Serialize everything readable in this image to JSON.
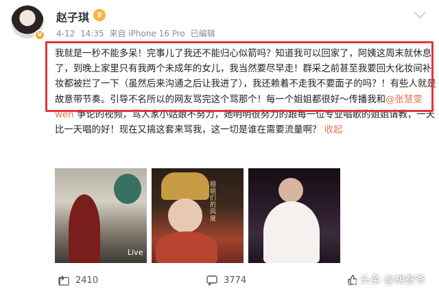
{
  "post": {
    "author": {
      "name": "赵子琪",
      "badge_icon": "crown-badge-icon",
      "vip_glyph": "V"
    },
    "meta": {
      "date": "4-12",
      "time": "14:35",
      "source": "来自 iPhone 16 Pro",
      "edited": "已编辑"
    },
    "text": {
      "p1": "我就是一秒不能多呆！完事儿了我还不能归心似箭吗？知道我可以回家了，阿姨这周末就休息了，到晚上家里只有我两个未成年的女儿，我当然要尽早走！群采之前甚至我要回大化妆间补妆都被拦了一下（虽然后来沟通之后让我进了），我还赖着不走我不要面子的吗？！有些人就是故意带节奏。引导不名所以的网友骂完这个骂那个！每一个姐姐都很好～传播我和",
      "mention": "@张慧雯wen",
      "p2": " 争论的视频，骂人家小姑娘不努力，她明明很努力的跟每一位专业唱歌的姐姐请教，一天比一天唱的好！现在又搞这套来骂我，这一切是谁在需要流量啊？",
      "collapse": "收起"
    },
    "photos": {
      "live_label": "Live",
      "photo2_caption": "姐姐们的风度"
    },
    "actions": {
      "repost_count": "2410",
      "comment_count": "3774",
      "like_count": ""
    },
    "colors": {
      "accent": "#eb7350",
      "highlight": "#e2353b"
    }
  },
  "watermark": {
    "text": "头条 @胡叁爷"
  }
}
